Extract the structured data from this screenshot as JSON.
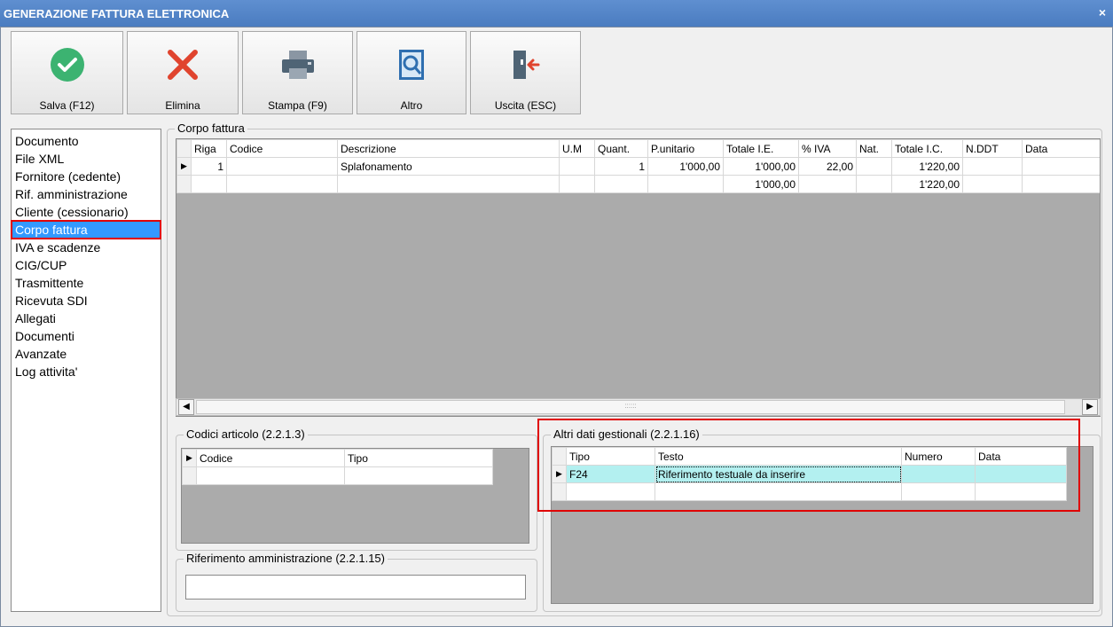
{
  "window": {
    "title": "GENERAZIONE FATTURA ELETTRONICA",
    "close_glyph": "×"
  },
  "toolbar": {
    "save_label": "Salva (F12)",
    "delete_label": "Elimina",
    "print_label": "Stampa (F9)",
    "other_label": "Altro",
    "exit_label": "Uscita (ESC)"
  },
  "sidebar": {
    "items": [
      {
        "label": "Documento"
      },
      {
        "label": "File XML"
      },
      {
        "label": "Fornitore (cedente)"
      },
      {
        "label": "Rif. amministrazione"
      },
      {
        "label": "Cliente (cessionario)"
      },
      {
        "label": "Corpo fattura"
      },
      {
        "label": "IVA e scadenze"
      },
      {
        "label": "CIG/CUP"
      },
      {
        "label": "Trasmittente"
      },
      {
        "label": "Ricevuta SDI"
      },
      {
        "label": "Allegati"
      },
      {
        "label": "Documenti"
      },
      {
        "label": "Avanzate"
      },
      {
        "label": "Log attivita'"
      }
    ],
    "selected": "Corpo fattura"
  },
  "corpo": {
    "legend": "Corpo fattura",
    "columns": [
      "Riga",
      "Codice",
      "Descrizione",
      "U.M",
      "Quant.",
      "P.unitario",
      "Totale I.E.",
      "% IVA",
      "Nat.",
      "Totale I.C.",
      "N.DDT",
      "Data"
    ],
    "row": {
      "riga": "1",
      "codice": "",
      "descrizione": "Splafonamento",
      "um": "",
      "quant": "1",
      "punitario": "1'000,00",
      "totale_ie": "1'000,00",
      "iva": "22,00",
      "nat": "",
      "totale_ic": "1'220,00",
      "nddt": "",
      "data": ""
    },
    "totals": {
      "totale_ie": "1'000,00",
      "totale_ic": "1'220,00"
    },
    "scroll_grip": "::::::"
  },
  "codici": {
    "legend": "Codici articolo (2.2.1.3)",
    "columns": [
      "Codice",
      "Tipo"
    ]
  },
  "altri": {
    "legend": "Altri dati gestionali (2.2.1.16)",
    "columns": [
      "Tipo",
      "Testo",
      "Numero",
      "Data"
    ],
    "row": {
      "tipo": "F24",
      "testo": "Riferimento testuale da inserire",
      "numero": "",
      "data": ""
    }
  },
  "rifamm": {
    "legend": "Riferimento amministrazione (2.2.1.15)",
    "value": ""
  },
  "colors": {
    "accent": "#3399ff",
    "highlight": "#e00000",
    "row_highlight": "#b3f0f0",
    "titlebar": "#4a7cc0"
  }
}
